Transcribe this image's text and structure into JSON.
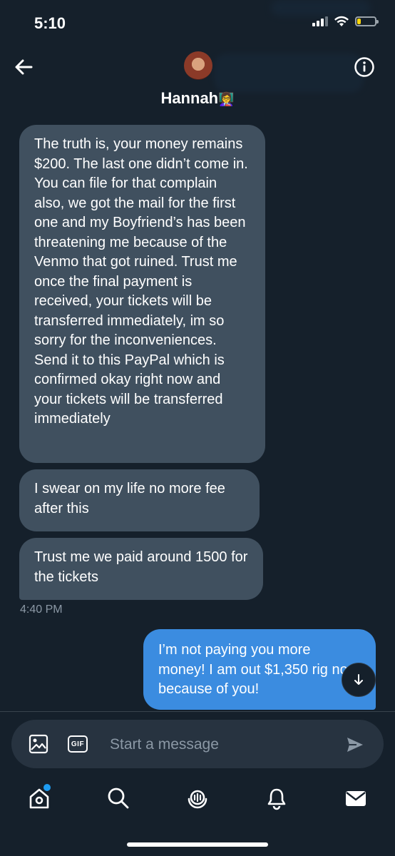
{
  "status_bar": {
    "time": "5:10",
    "battery_level": 0.2
  },
  "header": {
    "contact_name": "Hannah",
    "contact_emoji": "👩‍🏫"
  },
  "messages": [
    {
      "direction": "incoming",
      "text": "The truth is, your money remains $200. The last one didn’t come in. You can file for that complain also, we got the mail for the first one and my Boyfriend’s has been threatening me because of the Venmo that got ruined. Trust me once the final payment is received, your tickets will be transferred immediately, im so sorry for the inconveniences. Send it to this PayPal which is confirmed okay right now and your tickets will be transferred immediately"
    },
    {
      "direction": "incoming",
      "text": "I swear on my life no more fee after this"
    },
    {
      "direction": "incoming",
      "text": "Trust me we paid around 1500 for the tickets"
    },
    {
      "direction": "outgoing",
      "text": "I’m not paying you more money! I am out $1,350 rig  now because of you!"
    }
  ],
  "timestamp": "4:40 PM",
  "composer": {
    "placeholder": "Start a message",
    "gif_label": "GIF"
  },
  "tab_bar": {
    "items": [
      "home-icon",
      "search-icon",
      "spaces-icon",
      "notifications-icon",
      "messages-icon"
    ],
    "active": "messages-icon",
    "home_has_dot": true
  },
  "colors": {
    "background": "#15202b",
    "incoming_bubble": "#40505f",
    "outgoing_bubble": "#3b8ce0",
    "muted_text": "#8b98a5",
    "accent": "#1d9bf0"
  }
}
